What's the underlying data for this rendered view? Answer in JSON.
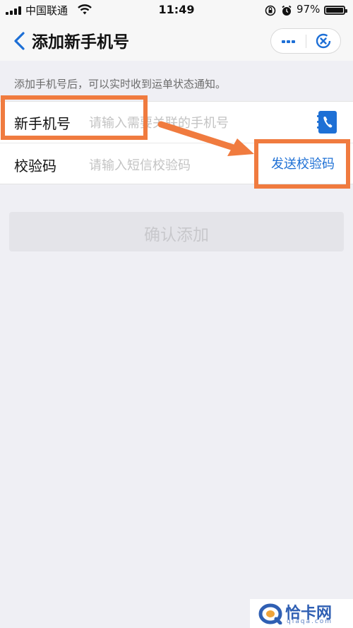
{
  "status_bar": {
    "carrier": "中国联通",
    "time": "11:49",
    "battery_percent": "97%",
    "battery_level": 0.97,
    "icons": [
      "signal-icon",
      "wifi-icon",
      "orientation-lock-icon",
      "alarm-icon",
      "battery-icon"
    ]
  },
  "nav": {
    "title": "添加新手机号",
    "back_icon": "chevron-left-icon",
    "more_icon": "more-dots-icon",
    "close_icon": "close-circle-icon"
  },
  "hint": "添加手机号后，可以实时收到运单状态通知。",
  "form": {
    "phone_label": "新手机号",
    "phone_placeholder": "请输入需要关联的手机号",
    "phone_value": "",
    "contact_icon": "contact-book-icon",
    "code_label": "校验码",
    "code_placeholder": "请输入短信校验码",
    "code_value": "",
    "send_code_label": "发送校验码"
  },
  "confirm_label": "确认添加",
  "watermark": {
    "text": "恰卡网",
    "subtext": "qiaqa.com"
  },
  "colors": {
    "accent": "#1e70d5",
    "highlight": "#f07b3f",
    "background": "#efeff4"
  }
}
